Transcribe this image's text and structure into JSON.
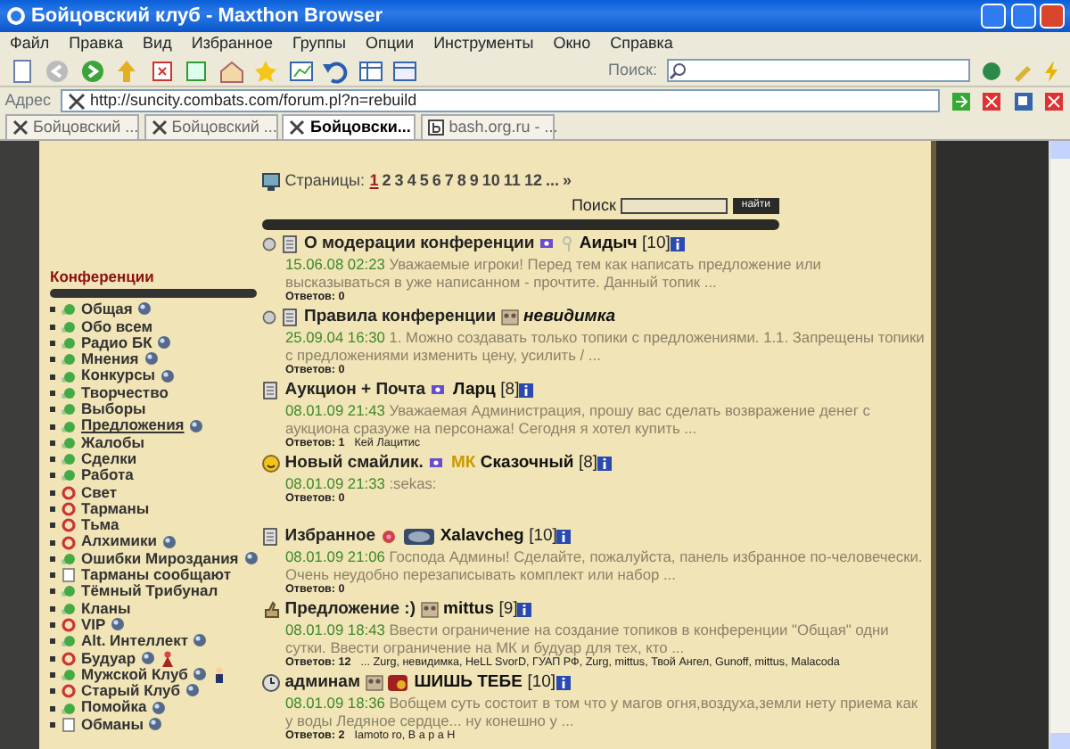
{
  "window": {
    "title": "Бойцовский клуб - Maxthon Browser"
  },
  "menu": [
    "Файл",
    "Правка",
    "Вид",
    "Избранное",
    "Группы",
    "Опции",
    "Инструменты",
    "Окно",
    "Справка"
  ],
  "toolbar": {
    "search_label": "Поиск:"
  },
  "address": {
    "label": "Адрес",
    "url": "http://suncity.combats.com/forum.pl?n=rebuild"
  },
  "tabs": [
    {
      "label": "Бойцовский ...",
      "selected": false,
      "kind": "swords"
    },
    {
      "label": "Бойцовский ...",
      "selected": false,
      "kind": "swords"
    },
    {
      "label": "Бойцовски...",
      "selected": true,
      "kind": "swords"
    },
    {
      "label": "bash.org.ru - ...",
      "selected": false,
      "kind": "letter"
    }
  ],
  "sidebar": {
    "title": "Конференции",
    "items": [
      {
        "name": "Общая",
        "kind": "open",
        "selected": false,
        "globe": true
      },
      {
        "name": "Обо всем",
        "kind": "open",
        "selected": false,
        "globe": false
      },
      {
        "name": "Радио БК",
        "kind": "open",
        "selected": false,
        "globe": true
      },
      {
        "name": "Мнения",
        "kind": "open",
        "selected": false,
        "globe": true
      },
      {
        "name": "Конкурсы",
        "kind": "open",
        "selected": false,
        "globe": true
      },
      {
        "name": "Творчество",
        "kind": "open",
        "selected": false,
        "globe": false
      },
      {
        "name": "Выборы",
        "kind": "open",
        "selected": false,
        "globe": false
      },
      {
        "name": "Предложения",
        "kind": "open",
        "selected": true,
        "globe": true
      },
      {
        "name": "Жалобы",
        "kind": "open",
        "selected": false,
        "globe": false
      },
      {
        "name": "Сделки",
        "kind": "open",
        "selected": false,
        "globe": false
      },
      {
        "name": "Работа",
        "kind": "open",
        "selected": false,
        "globe": false
      },
      {
        "name": "Свет",
        "kind": "closed",
        "selected": false,
        "globe": false
      },
      {
        "name": "Тарманы",
        "kind": "closed",
        "selected": false,
        "globe": false
      },
      {
        "name": "Тьма",
        "kind": "closed",
        "selected": false,
        "globe": false
      },
      {
        "name": "Алхимики",
        "kind": "closed",
        "selected": false,
        "globe": true
      },
      {
        "name": "Ошибки Мироздания",
        "kind": "open",
        "selected": false,
        "globe": true
      },
      {
        "name": "Тарманы сообщают",
        "kind": "doc",
        "selected": false,
        "globe": false
      },
      {
        "name": "Тёмный Трибунал",
        "kind": "open",
        "selected": false,
        "globe": false
      },
      {
        "name": "Кланы",
        "kind": "open",
        "selected": false,
        "globe": false
      },
      {
        "name": "VIP",
        "kind": "closed",
        "selected": false,
        "globe": true
      },
      {
        "name": "Alt. Интеллект",
        "kind": "open",
        "selected": false,
        "globe": true
      },
      {
        "name": "Будуар",
        "kind": "closed",
        "selected": false,
        "globe": true
      },
      {
        "name": "Мужской Клуб",
        "kind": "open",
        "selected": false,
        "globe": true
      },
      {
        "name": "Старый Клуб",
        "kind": "closed",
        "selected": false,
        "globe": true
      },
      {
        "name": "Помойка",
        "kind": "open",
        "selected": false,
        "globe": true
      },
      {
        "name": "Обманы",
        "kind": "doc",
        "selected": false,
        "globe": true
      }
    ]
  },
  "pages": {
    "label": "Страницы:",
    "items": [
      {
        "label": "1",
        "selected": true
      },
      {
        "label": "2",
        "selected": false
      },
      {
        "label": "3",
        "selected": false
      },
      {
        "label": "4",
        "selected": false
      },
      {
        "label": "5",
        "selected": false
      },
      {
        "label": "6",
        "selected": false
      },
      {
        "label": "7",
        "selected": false
      },
      {
        "label": "8",
        "selected": false
      },
      {
        "label": "9",
        "selected": false
      },
      {
        "label": "10",
        "selected": false
      },
      {
        "label": "11",
        "selected": false
      },
      {
        "label": "12",
        "selected": false
      },
      {
        "label": "...",
        "selected": false
      },
      {
        "label": "»",
        "selected": false
      }
    ]
  },
  "search": {
    "label": "Поиск",
    "button": "найти"
  },
  "topics": [
    {
      "kind": "doc",
      "pinned": true,
      "title": "О модерации конференции",
      "author": "Аидыч",
      "invisible": false,
      "level": "[10]",
      "date": "15.06.08 02:23",
      "text": "Уважаемые игроки! Перед тем как написать предложение или высказываться в уже написанном - прочтите. Данный топик ...",
      "replies": "Ответов: 0"
    },
    {
      "kind": "doc",
      "pinned": true,
      "title": "Правила конференции",
      "author": "невидимка",
      "invisible": true,
      "date": "25.09.04 16:30",
      "text": "1. Можно создавать только топики с предложениями. 1.1. Запрещены топики с предложениями изменить цену, усилить / ...",
      "replies": "Ответов: 0"
    },
    {
      "kind": "doc",
      "pinned": false,
      "title": "Аукцион + Почта",
      "author": "Ларц",
      "invisible": false,
      "level": "[8]",
      "date": "08.01.09 21:43",
      "text": "Уважаемая Администрация, прошу вас сделать возвражение денег с аукциона сразуже на персонажа! Сегодня я хотел купить ...",
      "replies": "Ответов: 1",
      "repliers": "Кей Лацитис"
    },
    {
      "kind": "smile",
      "pinned": false,
      "title": "Новый смайлик.",
      "clan": "МК",
      "author": "Сказочный",
      "invisible": false,
      "level": "[8]",
      "date": "08.01.09 21:33",
      "text": ":sekas:",
      "replies": "Ответов: 0"
    },
    {
      "kind": "doc",
      "pinned": false,
      "title": "Избранное",
      "author": "Xalavcheg",
      "invisible": false,
      "level": "[10]",
      "date": "08.01.09 21:06",
      "text": "Господа Админы! Сделайте, пожалуйста, панель избранное по-человечески. Очень неудобно перезаписывать комплект или набор ...",
      "replies": "Ответов: 0"
    },
    {
      "kind": "thumb",
      "pinned": false,
      "title": "Предложение :)",
      "author": "mittus",
      "invisible": false,
      "level": "[9]",
      "date": "08.01.09 18:43",
      "text": "Ввести ограничение на создание топиков в конференции \"Общая\" одни сутки. Ввести ограничение на МК и будуар для тех, кто ...",
      "replies": "Ответов: 12",
      "repliers": "... Zurg, невидимка, HeLL SvorD, ГУАП РФ, Zurg, mittus, Твой Ангел, Gunoff, mittus, Malacoda"
    },
    {
      "kind": "clock",
      "pinned": false,
      "title": "админам",
      "author": "ШИШЬ ТЕБЕ",
      "invisible": false,
      "level": "[10]",
      "date": "08.01.09 18:36",
      "text": "Вобщем суть состоит в том что у магов огня,воздуха,земли нету приема как у воды Ледяное сердце... ну конешно у ...",
      "replies": "Ответов: 2",
      "repliers": "Iamoto ro, В а р а Н"
    }
  ]
}
